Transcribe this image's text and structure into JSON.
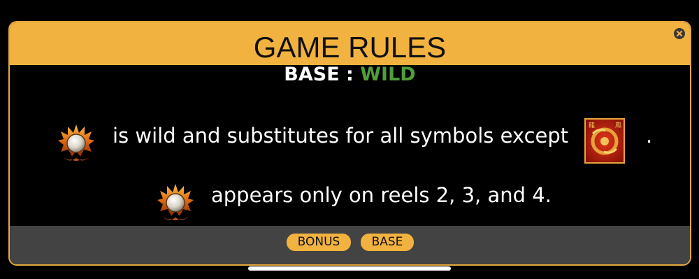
{
  "dialog": {
    "title": "GAME RULES",
    "close_icon": "close-icon"
  },
  "section": {
    "base_label": "BASE :",
    "wild_label": "WILD",
    "wild_color": "#4f9e3b"
  },
  "rules": {
    "line1_text": "is wild and substitutes for all symbols except",
    "line1_period": ".",
    "line2_text": "appears only on reels 2, 3, and 4.",
    "wild_symbol_icon": "pearl-flame-wild-icon",
    "bonus_symbol_icon": "dragon-bonus-symbol-icon"
  },
  "footer": {
    "tabs": [
      {
        "label": "BONUS"
      },
      {
        "label": "BASE"
      }
    ]
  },
  "colors": {
    "accent": "#f2b23f",
    "background": "#000000",
    "footer_bg": "#434343"
  }
}
